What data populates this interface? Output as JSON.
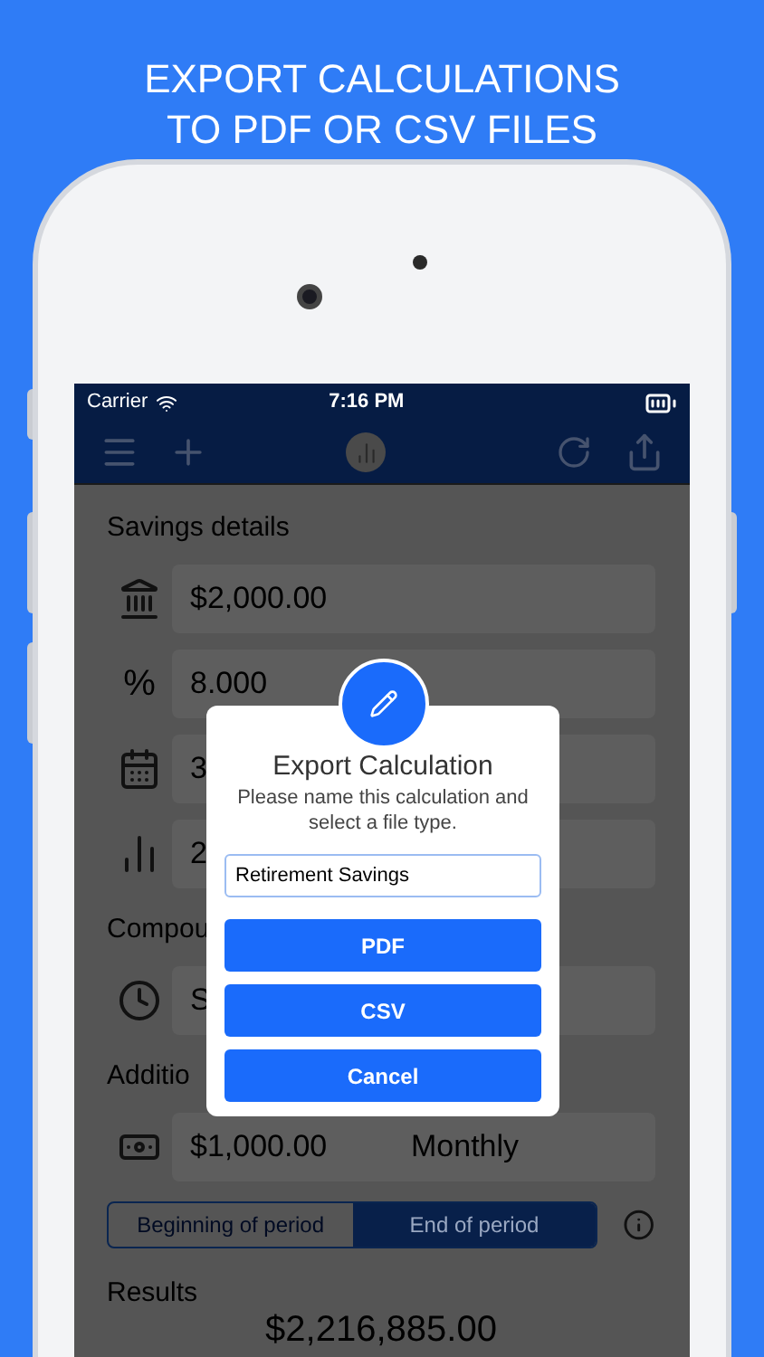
{
  "headline": [
    "EXPORT CALCULATIONS",
    "TO PDF OR CSV FILES"
  ],
  "status_bar": {
    "carrier": "Carrier",
    "time": "7:16 PM"
  },
  "sections": [
    {
      "title": "Savings details",
      "rows": [
        {
          "kind": "bank",
          "value": "$2,000.00"
        },
        {
          "kind": "symbol",
          "symbol": "%",
          "value": "8.000"
        },
        {
          "kind": "calendar",
          "value": "3"
        },
        {
          "kind": "chart",
          "value": "2"
        }
      ]
    },
    {
      "title": "Compou",
      "rows": [
        {
          "kind": "clock",
          "value": "S"
        }
      ]
    },
    {
      "title": "Additio",
      "rows": [
        {
          "kind": "money",
          "value": "$1,000.00",
          "value_2": "Monthly"
        }
      ]
    }
  ],
  "timing": [
    {
      "label": "Beginning of period",
      "selected": false
    },
    {
      "label": "End of period",
      "selected": true
    }
  ],
  "results": {
    "title": "Results",
    "amount": "$2,216,885.00"
  },
  "dialog": {
    "title": "Export Calculation",
    "message": "Please name this calculation and select a file type.",
    "name_value": "Retirement Savings",
    "buttons": [
      "PDF",
      "CSV",
      "Cancel"
    ]
  }
}
